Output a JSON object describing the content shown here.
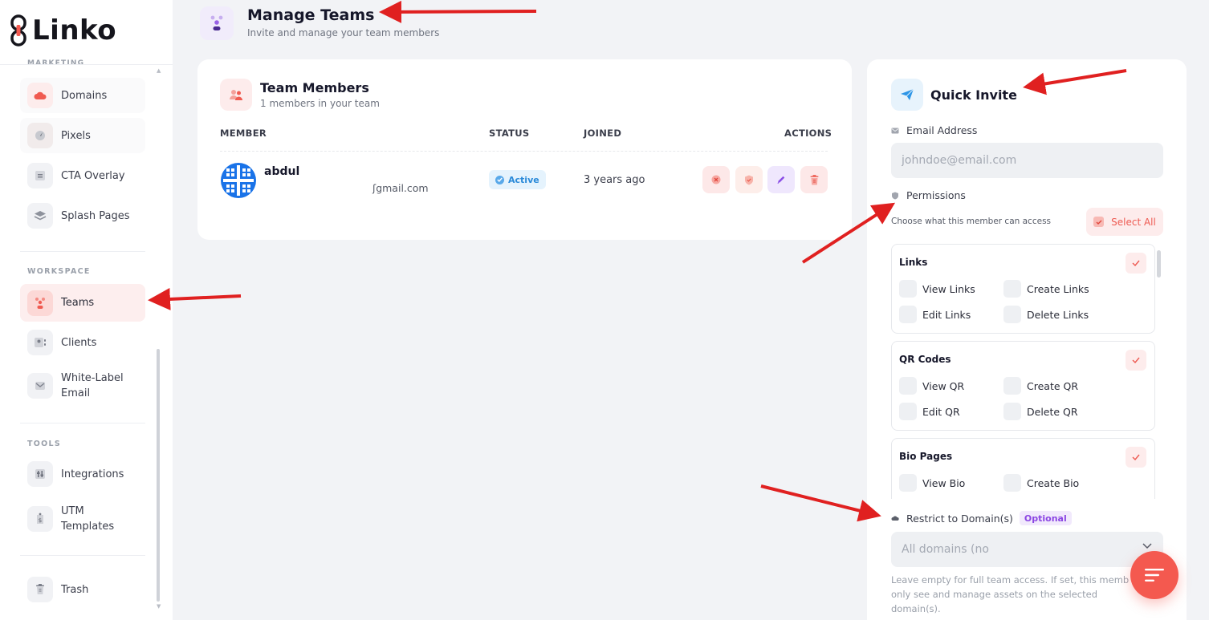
{
  "app": {
    "brand": "Linko",
    "brand_color": "#f4594f"
  },
  "sidebar": {
    "clipped_section_title": "MARKETING",
    "marketing_items": [
      {
        "label": "Domains",
        "icon": "cloud-icon"
      },
      {
        "label": "Pixels",
        "icon": "pixel-icon"
      },
      {
        "label": "CTA Overlay",
        "icon": "overlay-icon"
      },
      {
        "label": "Splash Pages",
        "icon": "layers-icon"
      }
    ],
    "workspace_title": "WORKSPACE",
    "workspace_items": [
      {
        "label": "Teams",
        "icon": "team-icon",
        "active": true
      },
      {
        "label": "Clients",
        "icon": "contact-card-icon"
      },
      {
        "label": "White-Label Email",
        "icon": "envelope-icon"
      }
    ],
    "tools_title": "TOOLS",
    "tools_items": [
      {
        "label": "Integrations",
        "icon": "sliders-icon"
      },
      {
        "label": "UTM Templates",
        "icon": "tag-dollar-icon"
      }
    ],
    "trash": {
      "label": "Trash",
      "icon": "trash-icon"
    }
  },
  "header": {
    "title": "Manage Teams",
    "subtitle": "Invite and manage your team members"
  },
  "team": {
    "title": "Team Members",
    "subtitle": "1 members in your team",
    "columns": [
      "MEMBER",
      "STATUS",
      "JOINED",
      "ACTIONS"
    ],
    "members": [
      {
        "name": "abdul",
        "email": "ʃgmail.com",
        "status": "Active",
        "joined": "3 years ago"
      }
    ]
  },
  "invite": {
    "title": "Quick Invite",
    "email_label": "Email Address",
    "email_placeholder": "johndoe@email.com",
    "permissions_label": "Permissions",
    "permissions_hint": "Choose what this member can access",
    "select_all_label": "Select All",
    "groups": [
      {
        "title": "Links",
        "options": [
          "View Links",
          "Create Links",
          "Edit Links",
          "Delete Links"
        ]
      },
      {
        "title": "QR Codes",
        "options": [
          "View QR",
          "Create QR",
          "Edit QR",
          "Delete QR"
        ]
      },
      {
        "title": "Bio Pages",
        "options": [
          "View Bio",
          "Create Bio"
        ]
      }
    ],
    "restrict_label": "Restrict to Domain(s)",
    "optional_badge": "Optional",
    "domain_select_value": "All domains (no",
    "domain_help": "Leave empty for full team access. If set, this memb only see and manage assets on the selected domain(s)."
  },
  "colors": {
    "accent_red": "#f4594f",
    "active_badge_blue": "#2a8ad9",
    "optional_purple": "#8b45e3",
    "annotation_arrow": "#e02020"
  }
}
